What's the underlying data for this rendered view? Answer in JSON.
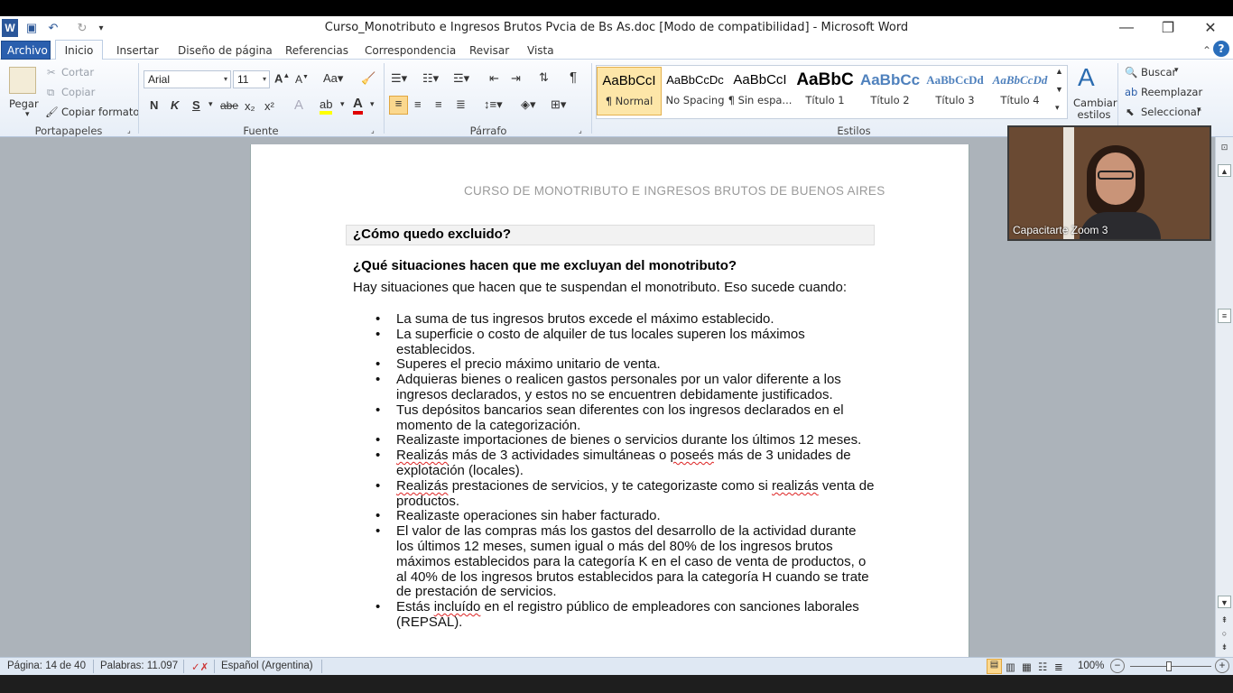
{
  "window": {
    "title": "Curso_Monotributo e Ingresos Brutos Pvcia de Bs As.doc [Modo de compatibilidad]  -  Microsoft Word",
    "minimize": "—",
    "restore": "❐",
    "close": "✕"
  },
  "quick_access": {
    "word_icon": "W",
    "save_icon": "💾",
    "undo_icon": "↶",
    "redo_icon": "↻",
    "customize_icon": "▾"
  },
  "tabs": [
    "Archivo",
    "Inicio",
    "Insertar",
    "Diseño de página",
    "Referencias",
    "Correspondencia",
    "Revisar",
    "Vista"
  ],
  "clipboard": {
    "paste": "Pegar",
    "cut": "Cortar",
    "copy": "Copiar",
    "format_painter": "Copiar formato",
    "label": "Portapapeles"
  },
  "font": {
    "name": "Arial",
    "size": "11",
    "label": "Fuente",
    "bold": "N",
    "italic": "K",
    "underline": "S",
    "strike": "abe",
    "sub": "x₂",
    "sup": "x²"
  },
  "paragraph": {
    "label": "Párrafo"
  },
  "styles": {
    "label": "Estilos",
    "items": [
      {
        "preview": "AaBbCcI",
        "name": "¶ Normal"
      },
      {
        "preview": "AaBbCcDc",
        "name": "No Spacing"
      },
      {
        "preview": "AaBbCcI",
        "name": "¶ Sin espa..."
      },
      {
        "preview": "AaBbC",
        "name": "Título 1"
      },
      {
        "preview": "AaBbCc",
        "name": "Título 2"
      },
      {
        "preview": "AaBbCcDd",
        "name": "Título 3"
      },
      {
        "preview": "AaBbCcDd",
        "name": "Título 4"
      }
    ],
    "change": "Cambiar estilos"
  },
  "editing": {
    "find": "Buscar",
    "replace": "Reemplazar",
    "select": "Seleccionar"
  },
  "document": {
    "header": "CURSO  DE MONOTRIBUTO   E INGRESOS  BRUTOS  DE BUENOS  AIRES",
    "heading1": "¿Cómo quedo excluido?",
    "heading2": "¿Qué situaciones hacen que me excluyan del monotributo?",
    "intro": "Hay situaciones que hacen que te suspendan el monotributo. Eso sucede cuando:",
    "bullets": [
      "La suma de tus ingresos brutos excede el máximo establecido.",
      "La superficie o costo de alquiler de tus locales superen los máximos establecidos.",
      "Superes el precio máximo unitario de venta.",
      "Adquieras bienes o realicen gastos personales por un valor diferente a los ingresos declarados, y estos no se encuentren debidamente justificados.",
      "Tus depósitos bancarios sean diferentes con los ingresos declarados en el momento de la categorización.",
      "Realizaste importaciones de bienes o servicios durante los últimos 12 meses.",
      "Realizás más de 3 actividades simultáneas o poseés más de 3 unidades de explotación (locales).",
      "Realizás prestaciones de servicios, y te categorizaste como si realizás venta de productos.",
      "Realizaste operaciones sin haber facturado.",
      "El valor de las compras más los gastos del desarrollo de la actividad durante los últimos 12 meses, sumen igual o más del 80% de los ingresos brutos máximos establecidos para la categoría K en el caso de venta de productos, o al 40% de los ingresos brutos establecidos para la categoría H cuando se trate de prestación de servicios.",
      "Estás incluído en el registro público de empleadores con sanciones laborales (REPSAL)."
    ]
  },
  "status": {
    "page": "Página: 14 de 40",
    "words": "Palabras: 11.097",
    "language": "Español (Argentina)",
    "zoom": "100%"
  },
  "video": {
    "name": "Capacitarte Zoom 3"
  }
}
